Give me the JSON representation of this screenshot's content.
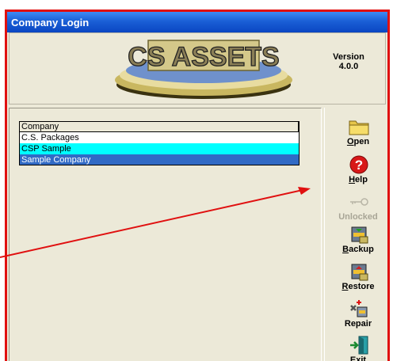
{
  "window": {
    "title": "Company Login"
  },
  "banner": {
    "logo_text": "CS ASSETS",
    "version_line1": "Version",
    "version_line2": "4.0.0"
  },
  "company_list": {
    "header": "Company",
    "rows": [
      "C.S. Packages",
      "CSP Sample",
      "Sample Company"
    ]
  },
  "toolbar": {
    "open": {
      "key": "O",
      "rest": "pen",
      "icon": "folder-icon"
    },
    "help": {
      "key": "H",
      "rest": "elp",
      "icon": "help-icon"
    },
    "unlocked": {
      "label": "Unlocked",
      "icon": "key-icon"
    },
    "backup": {
      "key": "B",
      "rest": "ackup",
      "icon": "backup-icon"
    },
    "restore": {
      "key": "R",
      "rest": "estore",
      "icon": "restore-icon"
    },
    "repair": {
      "label": "Repair",
      "icon": "repair-icon"
    },
    "exit": {
      "key": "x",
      "pre": "E",
      "rest": "it",
      "icon": "exit-door-icon"
    }
  },
  "colors": {
    "titlebar": "#0a46c2",
    "annotation_arrow": "#e01010",
    "row_cyan": "#00ffff",
    "row_selected": "#316ac5"
  }
}
